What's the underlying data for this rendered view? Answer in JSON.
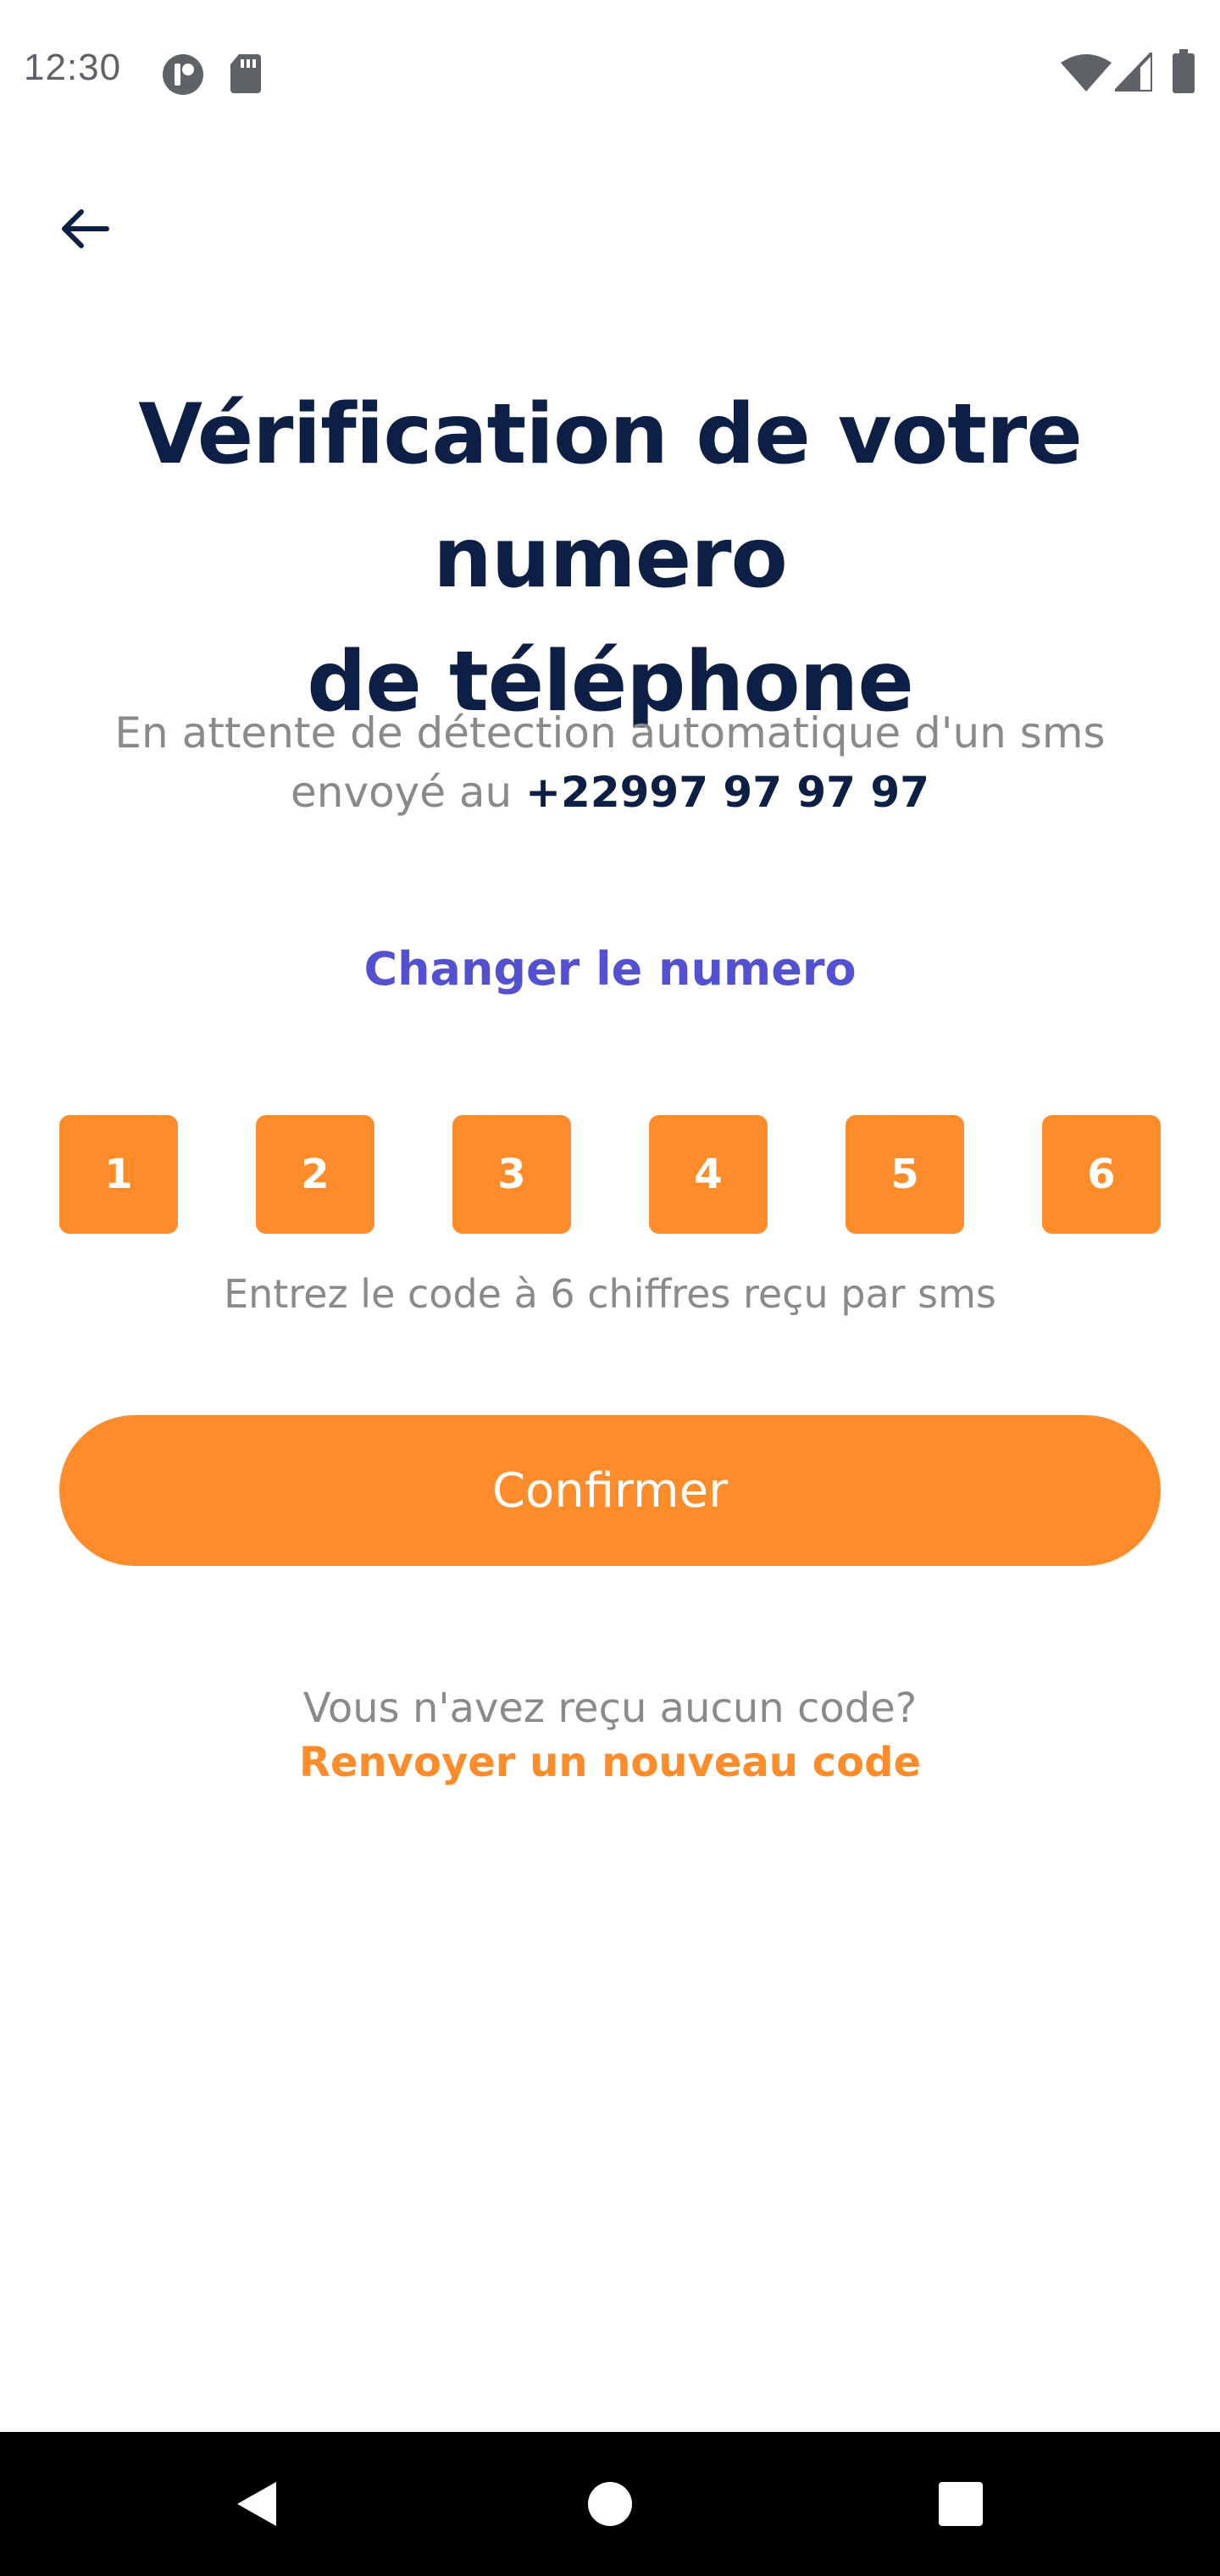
{
  "status_bar": {
    "time": "12:30",
    "icons_left": [
      "app-notification-icon",
      "sd-card-icon"
    ],
    "icons_right": [
      "wifi-icon",
      "signal-icon",
      "battery-icon"
    ]
  },
  "header": {
    "back_icon": "arrow-back-icon"
  },
  "title": {
    "line1": "Vérification de votre numero",
    "line2": "de téléphone"
  },
  "description": {
    "text": "En attente de détection automatique d'un sms envoyé au",
    "phone": "+22997 97 97 97"
  },
  "change_number_label": "Changer le numero",
  "otp": {
    "digits": [
      "1",
      "2",
      "3",
      "4",
      "5",
      "6"
    ],
    "hint": "Entrez le code à 6 chiffres reçu par sms"
  },
  "confirm_label": "Confirmer",
  "resend": {
    "question": "Vous n'avez reçu aucun code?",
    "link_label": "Renvoyer un nouveau code"
  },
  "navigation": {
    "buttons": [
      "back-nav-icon",
      "home-nav-icon",
      "recents-nav-icon"
    ]
  },
  "colors": {
    "accent": "#ff8c2b",
    "title": "#0d1f44",
    "link": "#5451d1",
    "muted": "#8a8a8a"
  }
}
